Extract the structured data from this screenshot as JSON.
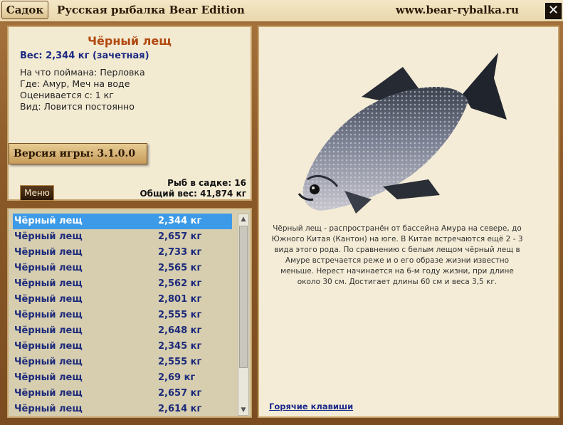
{
  "titlebar": {
    "tab_label": "Садок",
    "title": "Русская рыбалка Bear Edition",
    "site": "www.bear-rybalka.ru",
    "close_label": "✕"
  },
  "info": {
    "fish_name": "Чёрный лещ",
    "weight_line": "Вес: 2,344 кг (зачетная)",
    "caught_on": "На что поймана: Перловка",
    "where": "Где: Амур, Меч на воде",
    "rated_from": "Оценивается с: 1 кг",
    "kind": "Вид: Ловится постоянно",
    "version": "Версия игры: 3.1.0.0",
    "menu_label": "Меню",
    "fish_count": "Рыб в садке: 16",
    "total_weight": "Общий вес: 41,874 кг"
  },
  "list": {
    "rows": [
      {
        "name": "Чёрный лещ",
        "weight": "2,344 кг"
      },
      {
        "name": "Чёрный лещ",
        "weight": "2,657 кг"
      },
      {
        "name": "Чёрный лещ",
        "weight": "2,733 кг"
      },
      {
        "name": "Чёрный лещ",
        "weight": "2,565 кг"
      },
      {
        "name": "Чёрный лещ",
        "weight": "2,562 кг"
      },
      {
        "name": "Чёрный лещ",
        "weight": "2,801 кг"
      },
      {
        "name": "Чёрный лещ",
        "weight": "2,555 кг"
      },
      {
        "name": "Чёрный лещ",
        "weight": "2,648 кг"
      },
      {
        "name": "Чёрный лещ",
        "weight": "2,345 кг"
      },
      {
        "name": "Чёрный лещ",
        "weight": "2,555 кг"
      },
      {
        "name": "Чёрный лещ",
        "weight": "2,69 кг"
      },
      {
        "name": "Чёрный лещ",
        "weight": "2,657 кг"
      },
      {
        "name": "Чёрный лещ",
        "weight": "2,614 кг"
      }
    ]
  },
  "detail": {
    "description": "Чёрный лещ - распространён от бассейна Амура на севере, до Южного Китая (Кантон) на юге. В Китае встречаются ещё 2 - 3 вида этого рода. По сравнению с белым лещом чёрный лещ в Амуре встречается реже и о его образе жизни известно меньше. Нерест начинается на 6-м году жизни, при длине около 30 см. Достигает длины 60 см и веса 3,5 кг.",
    "hotkeys": "Горячие клавиши"
  }
}
